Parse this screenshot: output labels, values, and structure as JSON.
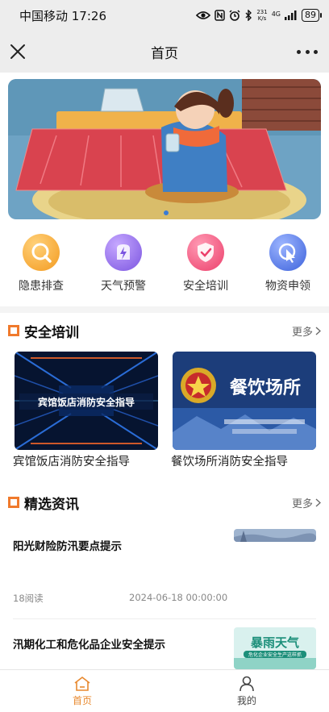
{
  "status_bar": {
    "carrier_time": "中国移动 17:26",
    "net_speed_value": "231",
    "net_speed_unit": "K/s",
    "signal": "4G",
    "battery": "89"
  },
  "header": {
    "title": "首页"
  },
  "quick_actions": [
    {
      "label": "隐患排查",
      "icon": "search-icon",
      "color": "#f5a623"
    },
    {
      "label": "天气预警",
      "icon": "lightning-icon",
      "color": "#8a63e8"
    },
    {
      "label": "安全培训",
      "icon": "shield-check-icon",
      "color": "#f2507b"
    },
    {
      "label": "物资申领",
      "icon": "cursor-click-icon",
      "color": "#4b6fe0"
    }
  ],
  "training": {
    "title": "安全培训",
    "more": "更多",
    "videos": [
      {
        "title": "宾馆饭店消防安全指导",
        "thumb_text": "宾馆饭店消防安全指导"
      },
      {
        "title": "餐饮场所消防安全指导",
        "thumb_text": "餐饮场所"
      }
    ]
  },
  "news": {
    "title": "精选资讯",
    "more": "更多",
    "items": [
      {
        "title": "阳光财险防汛要点提示",
        "reads": "18阅读",
        "time": "2024-06-18 00:00:00"
      },
      {
        "title": "汛期化工和危化品企业安全提示",
        "thumb_text": "暴雨天气",
        "thumb_sub": "危化企业安全生产这样抓"
      }
    ]
  },
  "tabbar": {
    "home": "首页",
    "mine": "我的"
  },
  "colors": {
    "accent": "#f07a2c",
    "tab_active": "#e8892f"
  }
}
